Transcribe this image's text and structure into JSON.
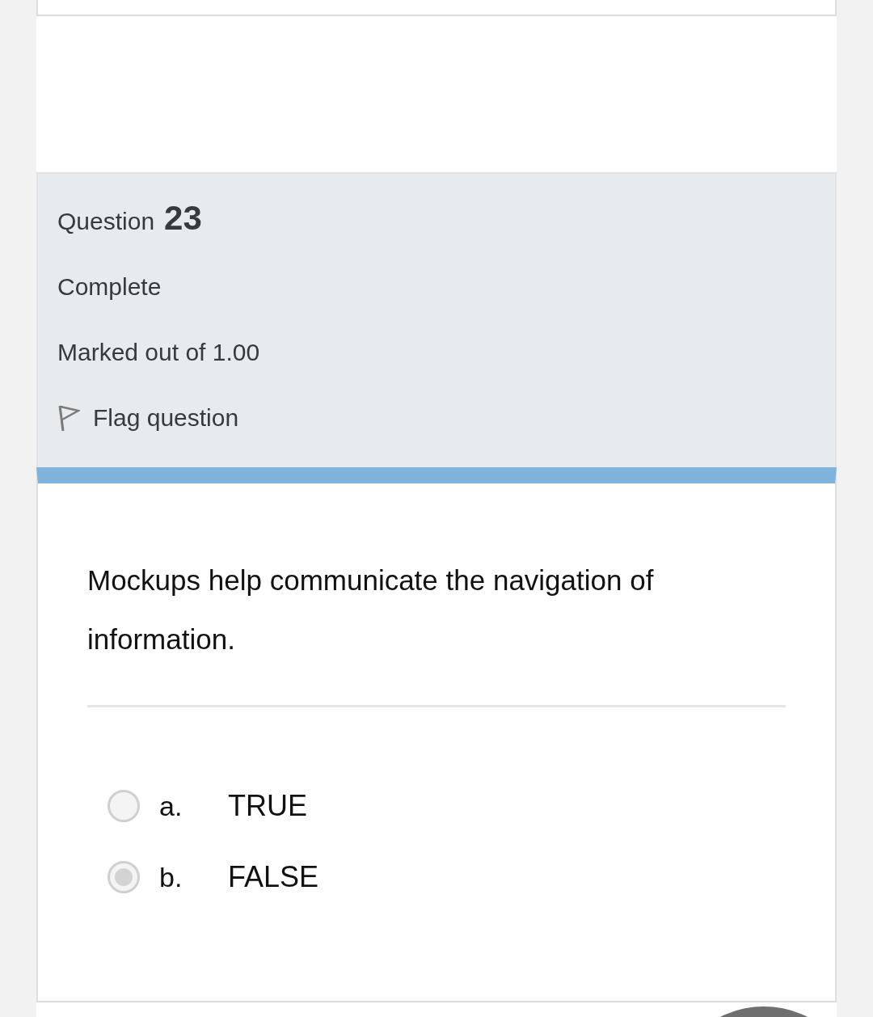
{
  "question": {
    "label": "Question",
    "number": "23",
    "status": "Complete",
    "grade": "Marked out of 1.00",
    "flag_label": "Flag question"
  },
  "prompt": "Mockups help communicate the navigation of information.",
  "answers": [
    {
      "letter": "a.",
      "text": "TRUE",
      "selected": false
    },
    {
      "letter": "b.",
      "text": "FALSE",
      "selected": true
    }
  ]
}
